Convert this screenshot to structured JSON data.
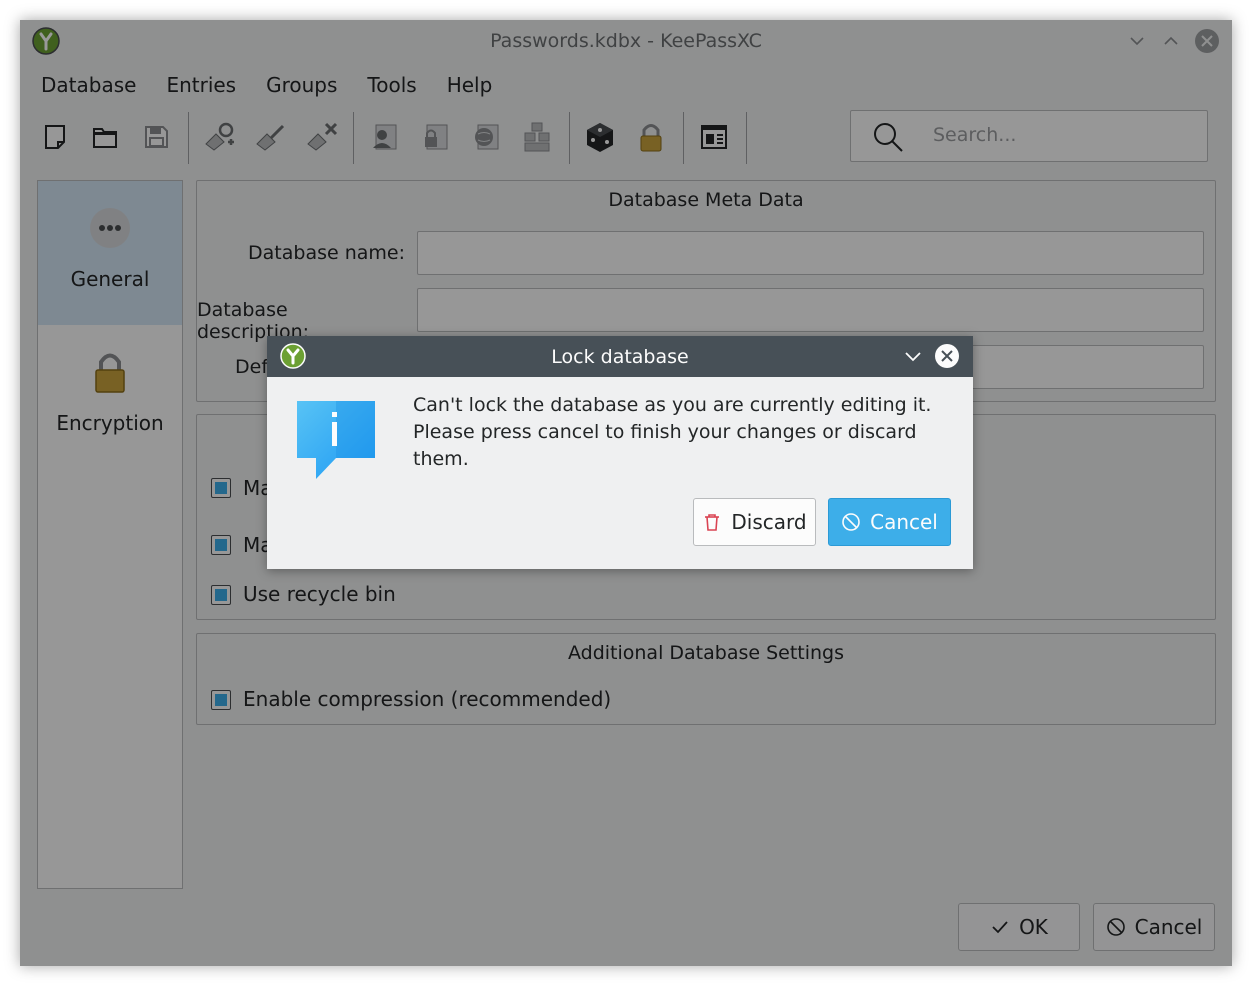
{
  "window": {
    "title": "Passwords.kdbx - KeePassXC"
  },
  "menu": [
    "Database",
    "Entries",
    "Groups",
    "Tools",
    "Help"
  ],
  "toolbar": {
    "icons": [
      "new-database-icon",
      "open-database-icon",
      "save-database-icon",
      "add-entry-icon",
      "edit-entry-icon",
      "delete-entry-icon",
      "copy-username-icon",
      "copy-password-icon",
      "copy-url-icon",
      "autotype-icon",
      "password-generator-icon",
      "lock-database-icon",
      "screenshot-icon"
    ]
  },
  "search": {
    "placeholder": "Search..."
  },
  "categories": [
    {
      "label": "General",
      "icon": "more-icon",
      "selected": true
    },
    {
      "label": "Encryption",
      "icon": "padlock-icon",
      "selected": false
    }
  ],
  "meta": {
    "title": "Database Meta Data",
    "name_label": "Database name:",
    "name_value": "",
    "description_label": "Database description:",
    "description_value": "",
    "default_label": "Def"
  },
  "history": {
    "max_items_label": "Ma",
    "max_size_label": "Ma",
    "recycle_label": "Use recycle bin"
  },
  "additional": {
    "title": "Additional Database Settings",
    "compression_label": "Enable compression (recommended)"
  },
  "footer": {
    "ok_label": "OK",
    "cancel_label": "Cancel"
  },
  "dialog": {
    "title": "Lock database",
    "message_line1": "Can't lock the database as you are currently editing it.",
    "message_line2": "Please press cancel to finish your changes or discard them.",
    "discard_label": "Discard",
    "cancel_label": "Cancel"
  },
  "colors": {
    "accent": "#3daee9",
    "dialog_title_bg": "#475057",
    "danger": "#da4453"
  }
}
